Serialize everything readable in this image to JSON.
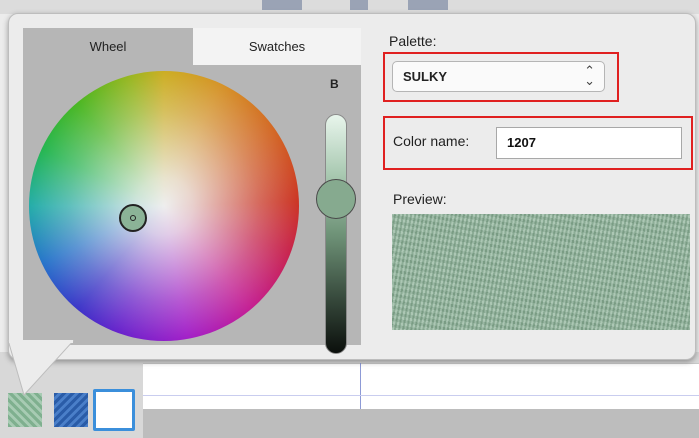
{
  "tabs": {
    "wheel": "Wheel",
    "swatches": "Swatches"
  },
  "slider": {
    "label": "B"
  },
  "palette": {
    "label": "Palette:",
    "selected": "SULKY",
    "chevron": "⌃\n⌄"
  },
  "color_name": {
    "label": "Color name:",
    "value": "1207"
  },
  "preview": {
    "label": "Preview:"
  },
  "colors": {
    "highlight": "#e02020",
    "current_color": "#8fb39a",
    "swatch_blue": "#2a5ca8",
    "selected_swatch_border": "#3b8fdb"
  }
}
